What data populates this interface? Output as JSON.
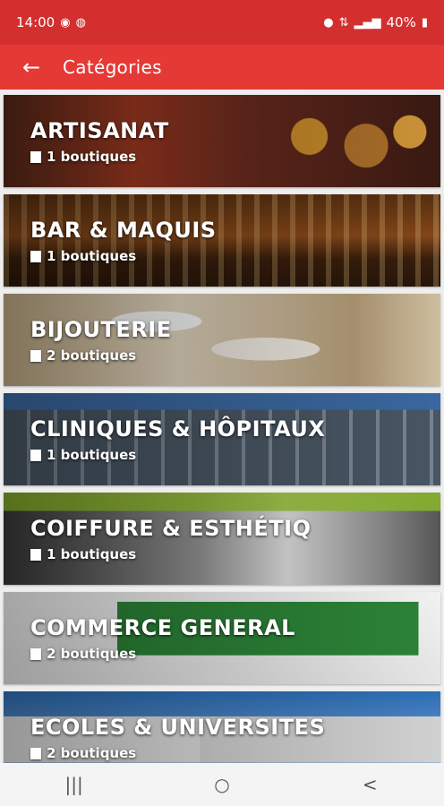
{
  "status_bar": {
    "time": "14:00",
    "left_icons": [
      "whatsapp-icon",
      "app-icon"
    ],
    "battery": "40%",
    "right_icons": [
      "location-icon",
      "data-icon",
      "signal-icon",
      "battery-icon"
    ]
  },
  "app_bar": {
    "title": "Catégories",
    "back_icon": "arrow-left-icon",
    "color": "#e53935"
  },
  "categories": [
    {
      "name": "ARTISANAT",
      "count": "1 boutiques"
    },
    {
      "name": "BAR & MAQUIS",
      "count": "1 boutiques"
    },
    {
      "name": "BIJOUTERIE",
      "count": "2 boutiques"
    },
    {
      "name": "CLINIQUES & HÔPITAUX",
      "count": "1 boutiques"
    },
    {
      "name": "COIFFURE & ESTHÉTIQ",
      "count": "1 boutiques"
    },
    {
      "name": "COMMERCE GENERAL",
      "count": "2 boutiques"
    },
    {
      "name": "ECOLES & UNIVERSITES",
      "count": "2 boutiques"
    }
  ],
  "nav_bar": {
    "recent": "|||",
    "home": "○",
    "back": "<"
  }
}
